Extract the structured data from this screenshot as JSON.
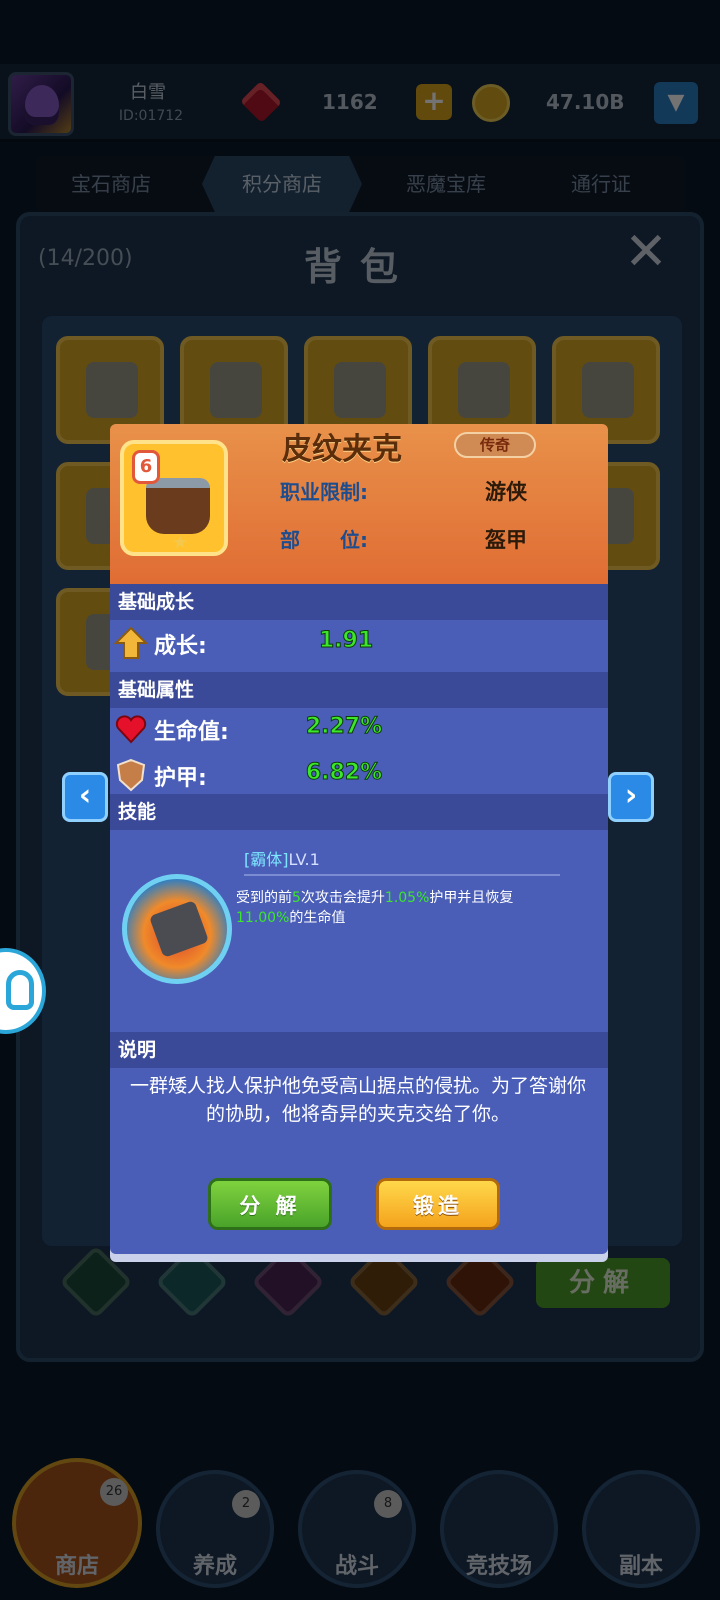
{
  "player": {
    "name": "白雪",
    "id": "ID:01712",
    "gems": "1162",
    "coins": "47.10B"
  },
  "tabs": [
    "宝石商店",
    "积分商店",
    "恶魔宝库",
    "通行证"
  ],
  "active_tab_index": 1,
  "backpack": {
    "count": "(14/200)",
    "title": "背包",
    "decompose_label": "分解"
  },
  "item": {
    "name": "皮纹夹克",
    "rarity": "传奇",
    "lock_level": "6",
    "class_label": "职业限制:",
    "class_value": "游侠",
    "slot_label": "部　　位:",
    "slot_value": "盔甲"
  },
  "growth": {
    "header": "基础成长",
    "label": "成长:",
    "value": "1.91"
  },
  "attributes": {
    "header": "基础属性",
    "hp_label": "生命值:",
    "hp_value": "2.27%",
    "armor_label": "护甲:",
    "armor_value": "6.82%"
  },
  "skill": {
    "header": "技能",
    "name": "[霸体]",
    "level": "LV.1",
    "desc_parts": [
      "受到的前",
      "5",
      "次攻击会提升",
      "1.05%",
      "护甲并且恢复",
      "11.00%",
      "的生命值"
    ]
  },
  "description": {
    "header": "说明",
    "text": "一群矮人找人保护他免受高山据点的侵扰。为了答谢你的协助，他将奇异的夹克交给了你。"
  },
  "buttons": {
    "decompose": "分 解",
    "forge": "锻造"
  },
  "nav": [
    {
      "label": "商店",
      "badge": "26"
    },
    {
      "label": "养成",
      "badge": "2"
    },
    {
      "label": "战斗",
      "badge": "8"
    },
    {
      "label": "竞技场",
      "badge": ""
    },
    {
      "label": "副本",
      "badge": ""
    }
  ]
}
